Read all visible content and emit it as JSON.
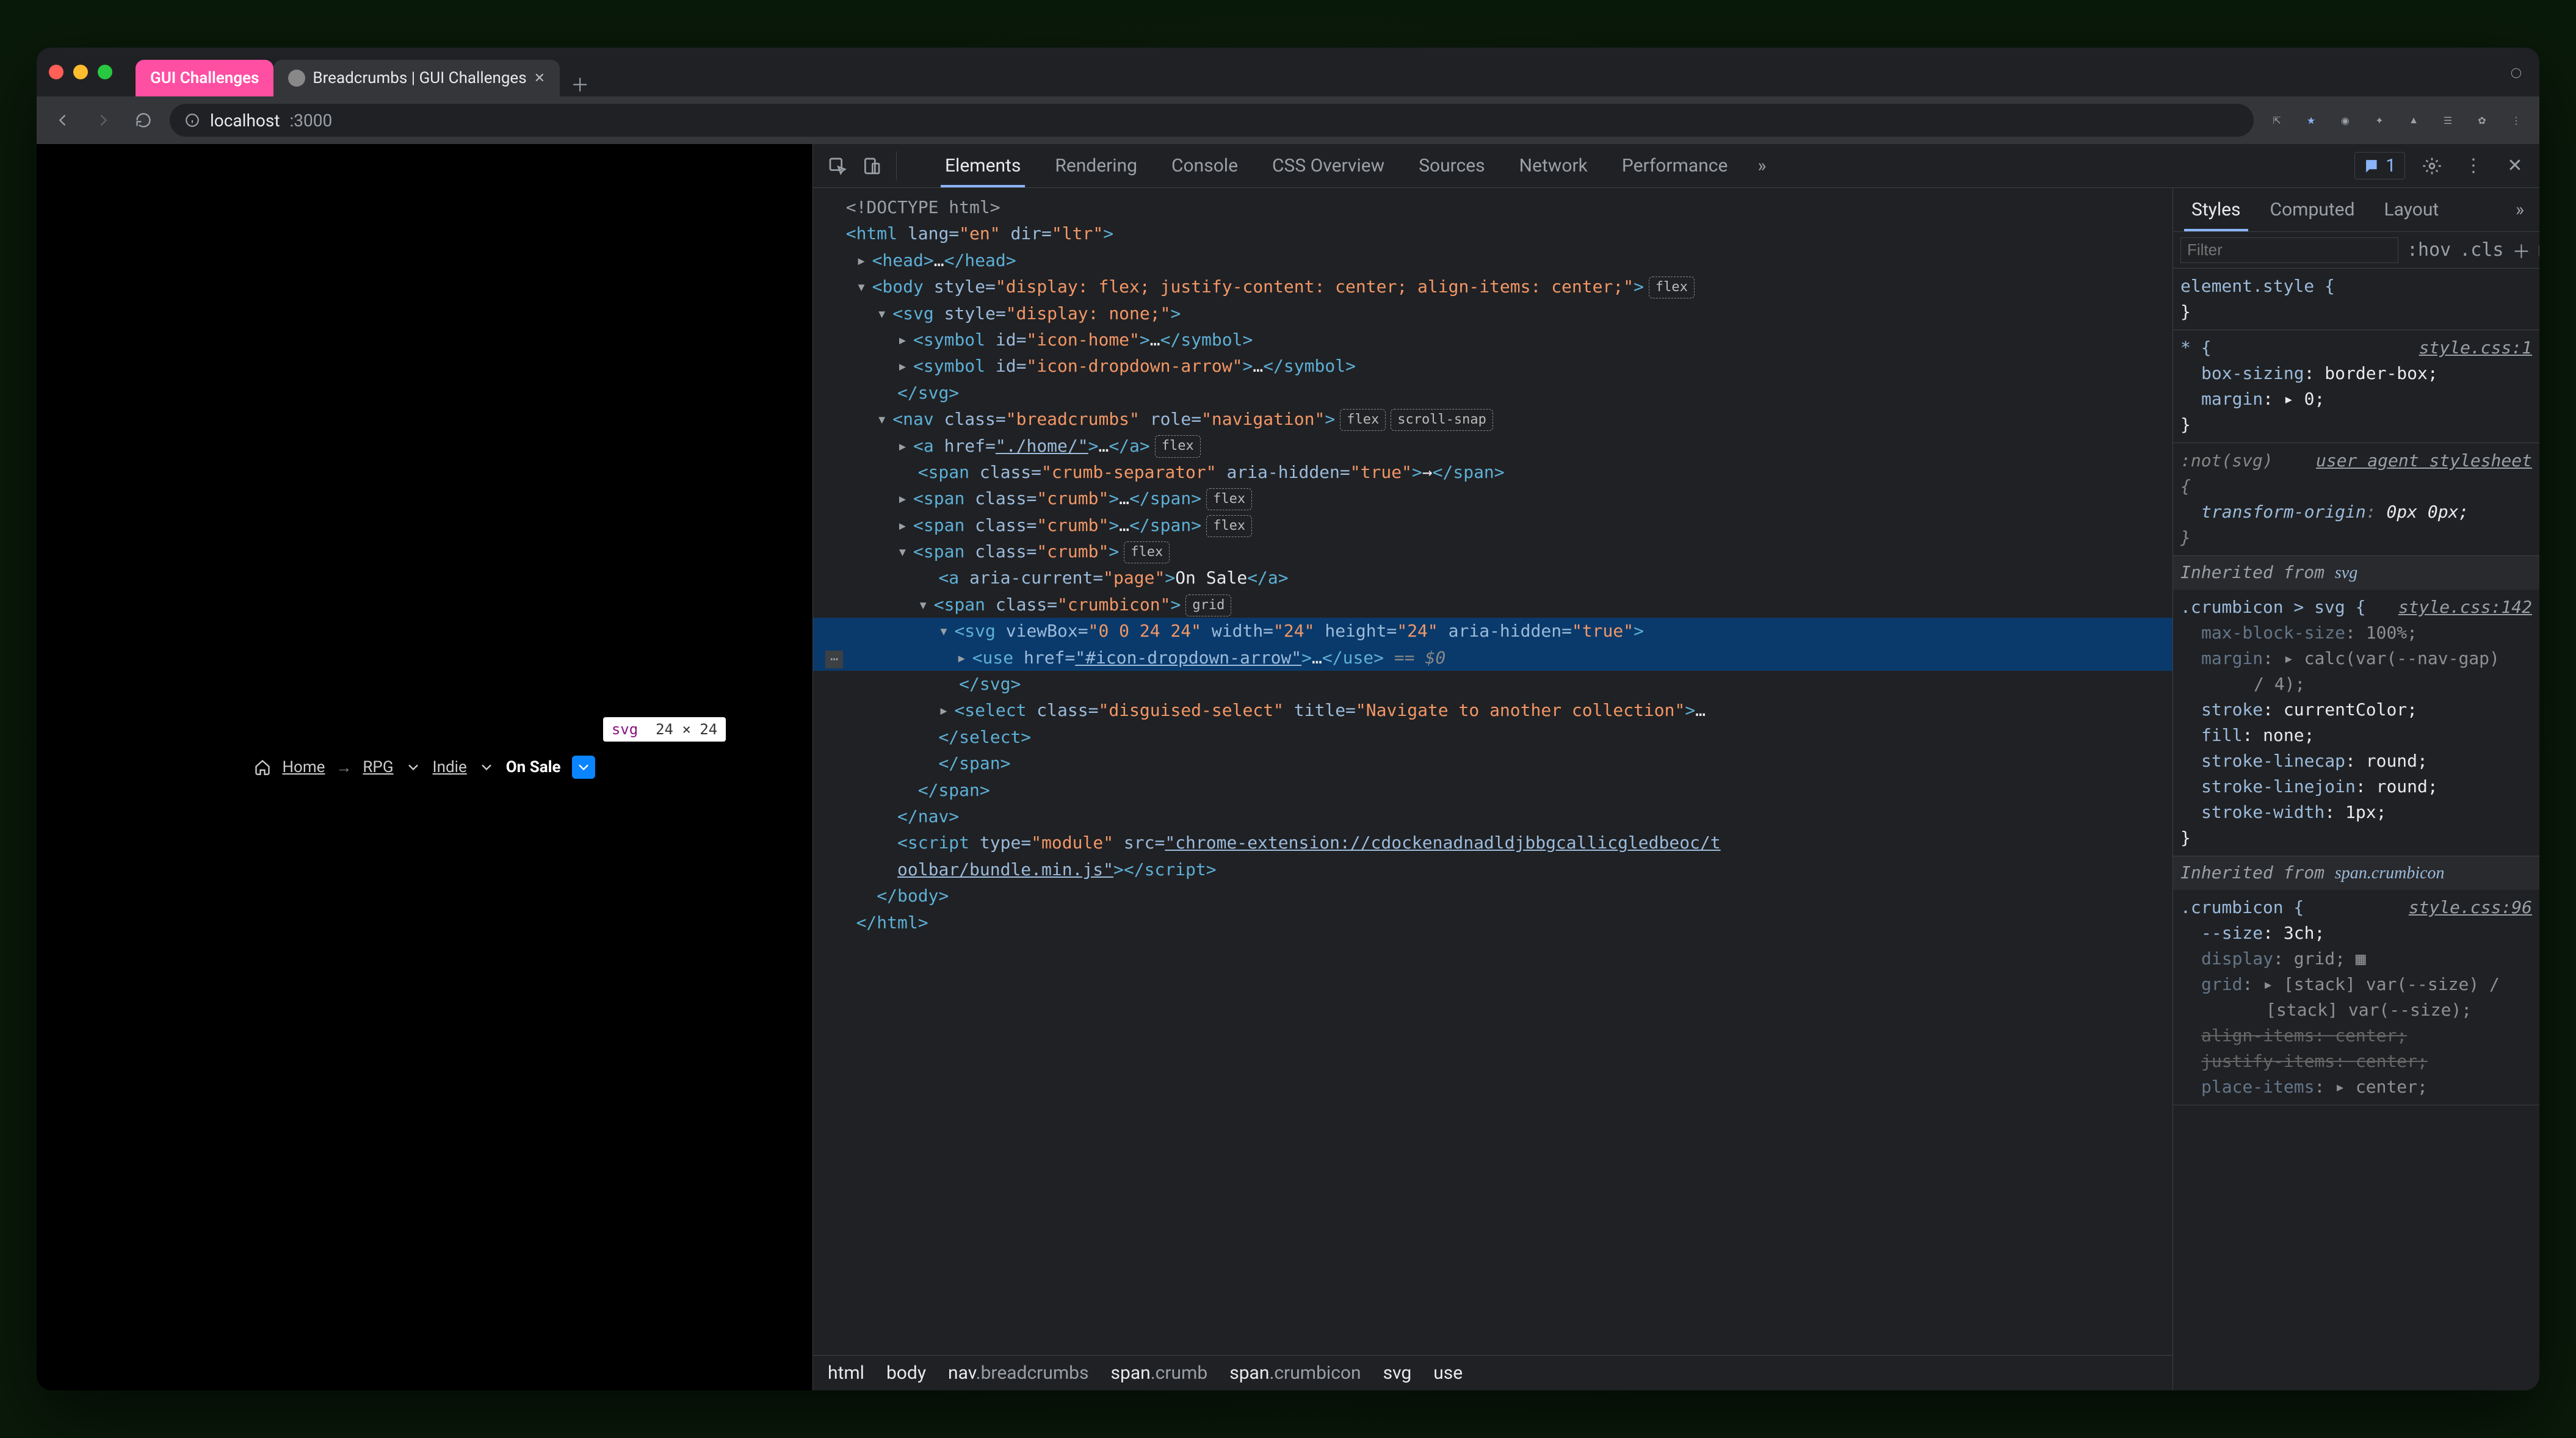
{
  "tabs": {
    "pink": "GUI Challenges",
    "active": "Breadcrumbs | GUI Challenges"
  },
  "addr": {
    "host": "localhost",
    "port": ":3000"
  },
  "breadcrumb_ui": {
    "home": "Home",
    "rpg": "RPG",
    "indie": "Indie",
    "onsale": "On Sale",
    "tooltip_tag": "svg",
    "tooltip_dims": "24 × 24"
  },
  "devtools_tabs": [
    "Elements",
    "Rendering",
    "Console",
    "CSS Overview",
    "Sources",
    "Network",
    "Performance"
  ],
  "issue_count": "1",
  "styles_tabs": [
    "Styles",
    "Computed",
    "Layout"
  ],
  "filter_placeholder": "Filter",
  "filter_hov": ":hov",
  "filter_cls": ".cls",
  "dom": {
    "l0": "<!DOCTYPE html>",
    "l1a": "<",
    "l1b": "html",
    "l1c": " lang=",
    "l1d": "\"en\"",
    "l1e": " dir=",
    "l1f": "\"ltr\"",
    "l1g": ">",
    "l2": "<head>…</head>",
    "l3_open": "<body style=",
    "l3_style": "\"display: flex; justify-content: center; align-items: center;\"",
    "l3_close": ">",
    "l4": "<svg style=",
    "l4s": "\"display: none;\"",
    "l4e": ">",
    "l5": "<symbol id=",
    "l5s": "\"icon-home\"",
    "l5e": ">…</symbol>",
    "l6": "<symbol id=",
    "l6s": "\"icon-dropdown-arrow\"",
    "l6e": ">…</symbol>",
    "l7": "</svg>",
    "l8": "<nav class=",
    "l8s": "\"breadcrumbs\"",
    "l8r": " role=",
    "l8rv": "\"navigation\"",
    "l8e": ">",
    "l9": "<a href=",
    "l9s": "\"./home/\"",
    "l9e": ">…</a>",
    "l10": "<span class=",
    "l10s": "\"crumb-separator\"",
    "l10a": " aria-hidden=",
    "l10av": "\"true\"",
    "l10e": ">→</span>",
    "l11": "<span class=",
    "l11s": "\"crumb\"",
    "l11e": ">…</span>",
    "l12": "<span class=",
    "l12s": "\"crumb\"",
    "l12e": ">…</span>",
    "l13": "<span class=",
    "l13s": "\"crumb\"",
    "l13e": ">",
    "l14": "<a aria-current=",
    "l14s": "\"page\"",
    "l14e": ">On Sale</a>",
    "l15": "<span class=",
    "l15s": "\"crumbicon\"",
    "l15e": ">",
    "l16": "<svg viewBox=",
    "l16s": "\"0 0 24 24\"",
    "l16w": " width=",
    "l16wv": "\"24\"",
    "l16h": " height=",
    "l16hv": "\"24\"",
    "l16a": " aria-hidden=",
    "l16av": "\"true\"",
    "l16e": ">",
    "l17": "<use href=",
    "l17s": "\"#icon-dropdown-arrow\"",
    "l17e": ">…</use>",
    "l17cur": " == $0",
    "l18": "</svg>",
    "l19": "<select class=",
    "l19s": "\"disguised-select\"",
    "l19t": " title=",
    "l19tv": "\"Navigate to another collection\"",
    "l19e": ">…",
    "l20": "</select>",
    "l21": "</span>",
    "l22": "</span>",
    "l23": "</nav>",
    "l24a": "<script type=",
    "l24b": "\"module\"",
    "l24c": " src=",
    "l24d": "\"chrome-extension://cdockenadnadldjbbgcallicgledbeoc/t",
    "l24d2": "oolbar/bundle.min.js\"",
    "l24e": "></script>",
    "l25": "</body>",
    "l26": "</html>",
    "badges": {
      "flex": "flex",
      "scroll": "scroll-snap",
      "grid": "grid"
    }
  },
  "crumb_trail": [
    "html",
    "body",
    "nav",
    "breadcrumbs",
    "span",
    "crumb",
    "span",
    "crumbicon",
    "svg",
    "use"
  ],
  "styles": {
    "r0": {
      "sel": "element.style {",
      "close": "}"
    },
    "r1": {
      "sel": "* {",
      "src": "style.css:1",
      "p": [
        [
          "box-sizing",
          "border-box;"
        ],
        [
          "margin",
          "▸ 0;"
        ]
      ],
      "close": "}"
    },
    "r2": {
      "sel": ":not(svg)",
      "src": "user agent stylesheet",
      "open": "{",
      "p": [
        [
          "transform-origin",
          "0px 0px;"
        ]
      ],
      "close": "}"
    },
    "inh1": "Inherited from ",
    "inh1t": "svg",
    "r3": {
      "sel": ".crumbicon > svg {",
      "src": "style.css:142",
      "p": [
        [
          "max-block-size",
          "100%;",
          true
        ],
        [
          "margin",
          "▸ calc(var(--nav-gap) / 4);",
          true
        ],
        [
          "stroke",
          "currentColor;"
        ],
        [
          "fill",
          "none;"
        ],
        [
          "stroke-linecap",
          "round;"
        ],
        [
          "stroke-linejoin",
          "round;"
        ],
        [
          "stroke-width",
          "1px;"
        ]
      ],
      "close": "}"
    },
    "inh2": "Inherited from ",
    "inh2t": "span.crumbicon",
    "r4": {
      "sel": ".crumbicon {",
      "src": "style.css:96",
      "p": [
        [
          "--size",
          "3ch;"
        ],
        [
          "display",
          "grid; ▦",
          true
        ],
        [
          "grid",
          "▸ [stack] var(--size) / [stack] var(--size);",
          true
        ],
        [
          "align-items",
          "center;",
          false,
          true
        ],
        [
          "justify-items",
          "center;",
          false,
          true
        ],
        [
          "place-items",
          "▸ center;",
          true
        ]
      ]
    }
  }
}
